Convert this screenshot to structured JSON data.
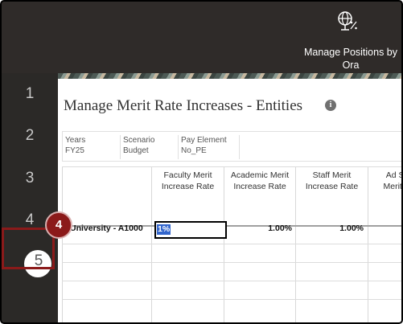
{
  "nav": {
    "label": "Manage Positions by Ora",
    "icon": "globe-percent-icon"
  },
  "steps": [
    "1",
    "2",
    "3",
    "4",
    "5"
  ],
  "page": {
    "title": "Manage Merit Rate Increases - Entities",
    "info_icon": "info-icon"
  },
  "pov": [
    {
      "label": "Years",
      "value": "FY25"
    },
    {
      "label": "Scenario",
      "value": "Budget"
    },
    {
      "label": "Pay Element",
      "value": "No_PE"
    }
  ],
  "grid": {
    "headers": [
      "Faculty Merit Increase Rate",
      "Academic Merit Increase Rate",
      "Staff Merit Increase Rate",
      "Ad Suppl Merit Ir Ra"
    ],
    "row": {
      "label": "University - A1000",
      "faculty": "1%",
      "academic": "1.00%",
      "staff": "1.00%"
    }
  },
  "callout": {
    "number": "4"
  },
  "colors": {
    "callout": "#8b1a1a",
    "selection": "#3366cc",
    "chrome": "#2f2b29"
  }
}
